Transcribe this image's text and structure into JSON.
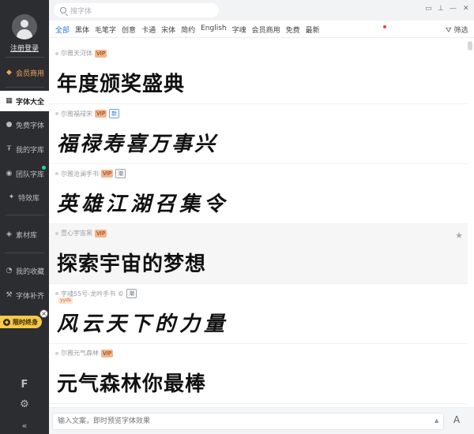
{
  "sidebar": {
    "login": "注册登录",
    "items": [
      {
        "label": "会员商用",
        "icon": "diamond-icon",
        "glyph": "◆"
      },
      {
        "label": "字体大全",
        "icon": "grid-icon",
        "glyph": "▦"
      },
      {
        "label": "免费字体",
        "icon": "free-icon",
        "glyph": "●"
      },
      {
        "label": "我的字库",
        "icon": "font-library-icon",
        "glyph": "Ŧ"
      },
      {
        "label": "团队字库",
        "icon": "team-icon",
        "glyph": "◉"
      },
      {
        "label": "特效库",
        "icon": "effects-icon",
        "glyph": "✦"
      },
      {
        "label": "素材库",
        "icon": "materials-icon",
        "glyph": "◈"
      },
      {
        "label": "我的收藏",
        "icon": "favorites-icon",
        "glyph": "◔"
      },
      {
        "label": "字体补齐",
        "icon": "wrench-icon",
        "glyph": "⚒"
      }
    ],
    "promo": "限时终身",
    "bottom_icons": [
      {
        "icon": "logo-f-icon",
        "glyph": "F"
      },
      {
        "icon": "settings-icon",
        "glyph": "⚙"
      },
      {
        "icon": "collapse-icon",
        "glyph": "«"
      }
    ]
  },
  "search": {
    "placeholder": "搜字体"
  },
  "window_controls": [
    {
      "icon": "message-icon",
      "glyph": "▭"
    },
    {
      "icon": "pin-icon",
      "glyph": "⊥"
    },
    {
      "icon": "minimize-icon",
      "glyph": "—"
    },
    {
      "icon": "close-icon",
      "glyph": "✕"
    }
  ],
  "categories": [
    "全部",
    "黑体",
    "毛笔字",
    "创意",
    "卡通",
    "宋体",
    "简约",
    "English",
    "字魂",
    "会员商用",
    "免费",
    "最新"
  ],
  "filter_label": "筛选",
  "fonts": [
    {
      "name": "尔雅天河体",
      "tags": [
        "VIP"
      ],
      "preview": "年度颁奖盛典",
      "style": "bold"
    },
    {
      "name": "尔雅福禄宋",
      "tags": [
        "VIP",
        "新"
      ],
      "preview": "福禄寿喜万事兴",
      "style": "brush"
    },
    {
      "name": "尔雅沧澜手书",
      "tags": [
        "VIP",
        "潮"
      ],
      "preview": "英雄江湖召集令",
      "style": "brush"
    },
    {
      "name": "壹心宇宙黑",
      "tags": [
        "VIP"
      ],
      "preview": "探索宇宙的梦想",
      "style": "bold"
    },
    {
      "name": "字魂55号-龙吟手书",
      "tags": [
        "潮"
      ],
      "extra_tag": "yyds",
      "preview": "风云天下的力量",
      "style": "brush"
    },
    {
      "name": "尔雅元气森林",
      "tags": [
        "VIP"
      ],
      "preview": "元气森林你最棒",
      "style": "bold"
    }
  ],
  "bottom": {
    "placeholder": "输入文案，即时预览字体效果",
    "size_label": "A"
  }
}
